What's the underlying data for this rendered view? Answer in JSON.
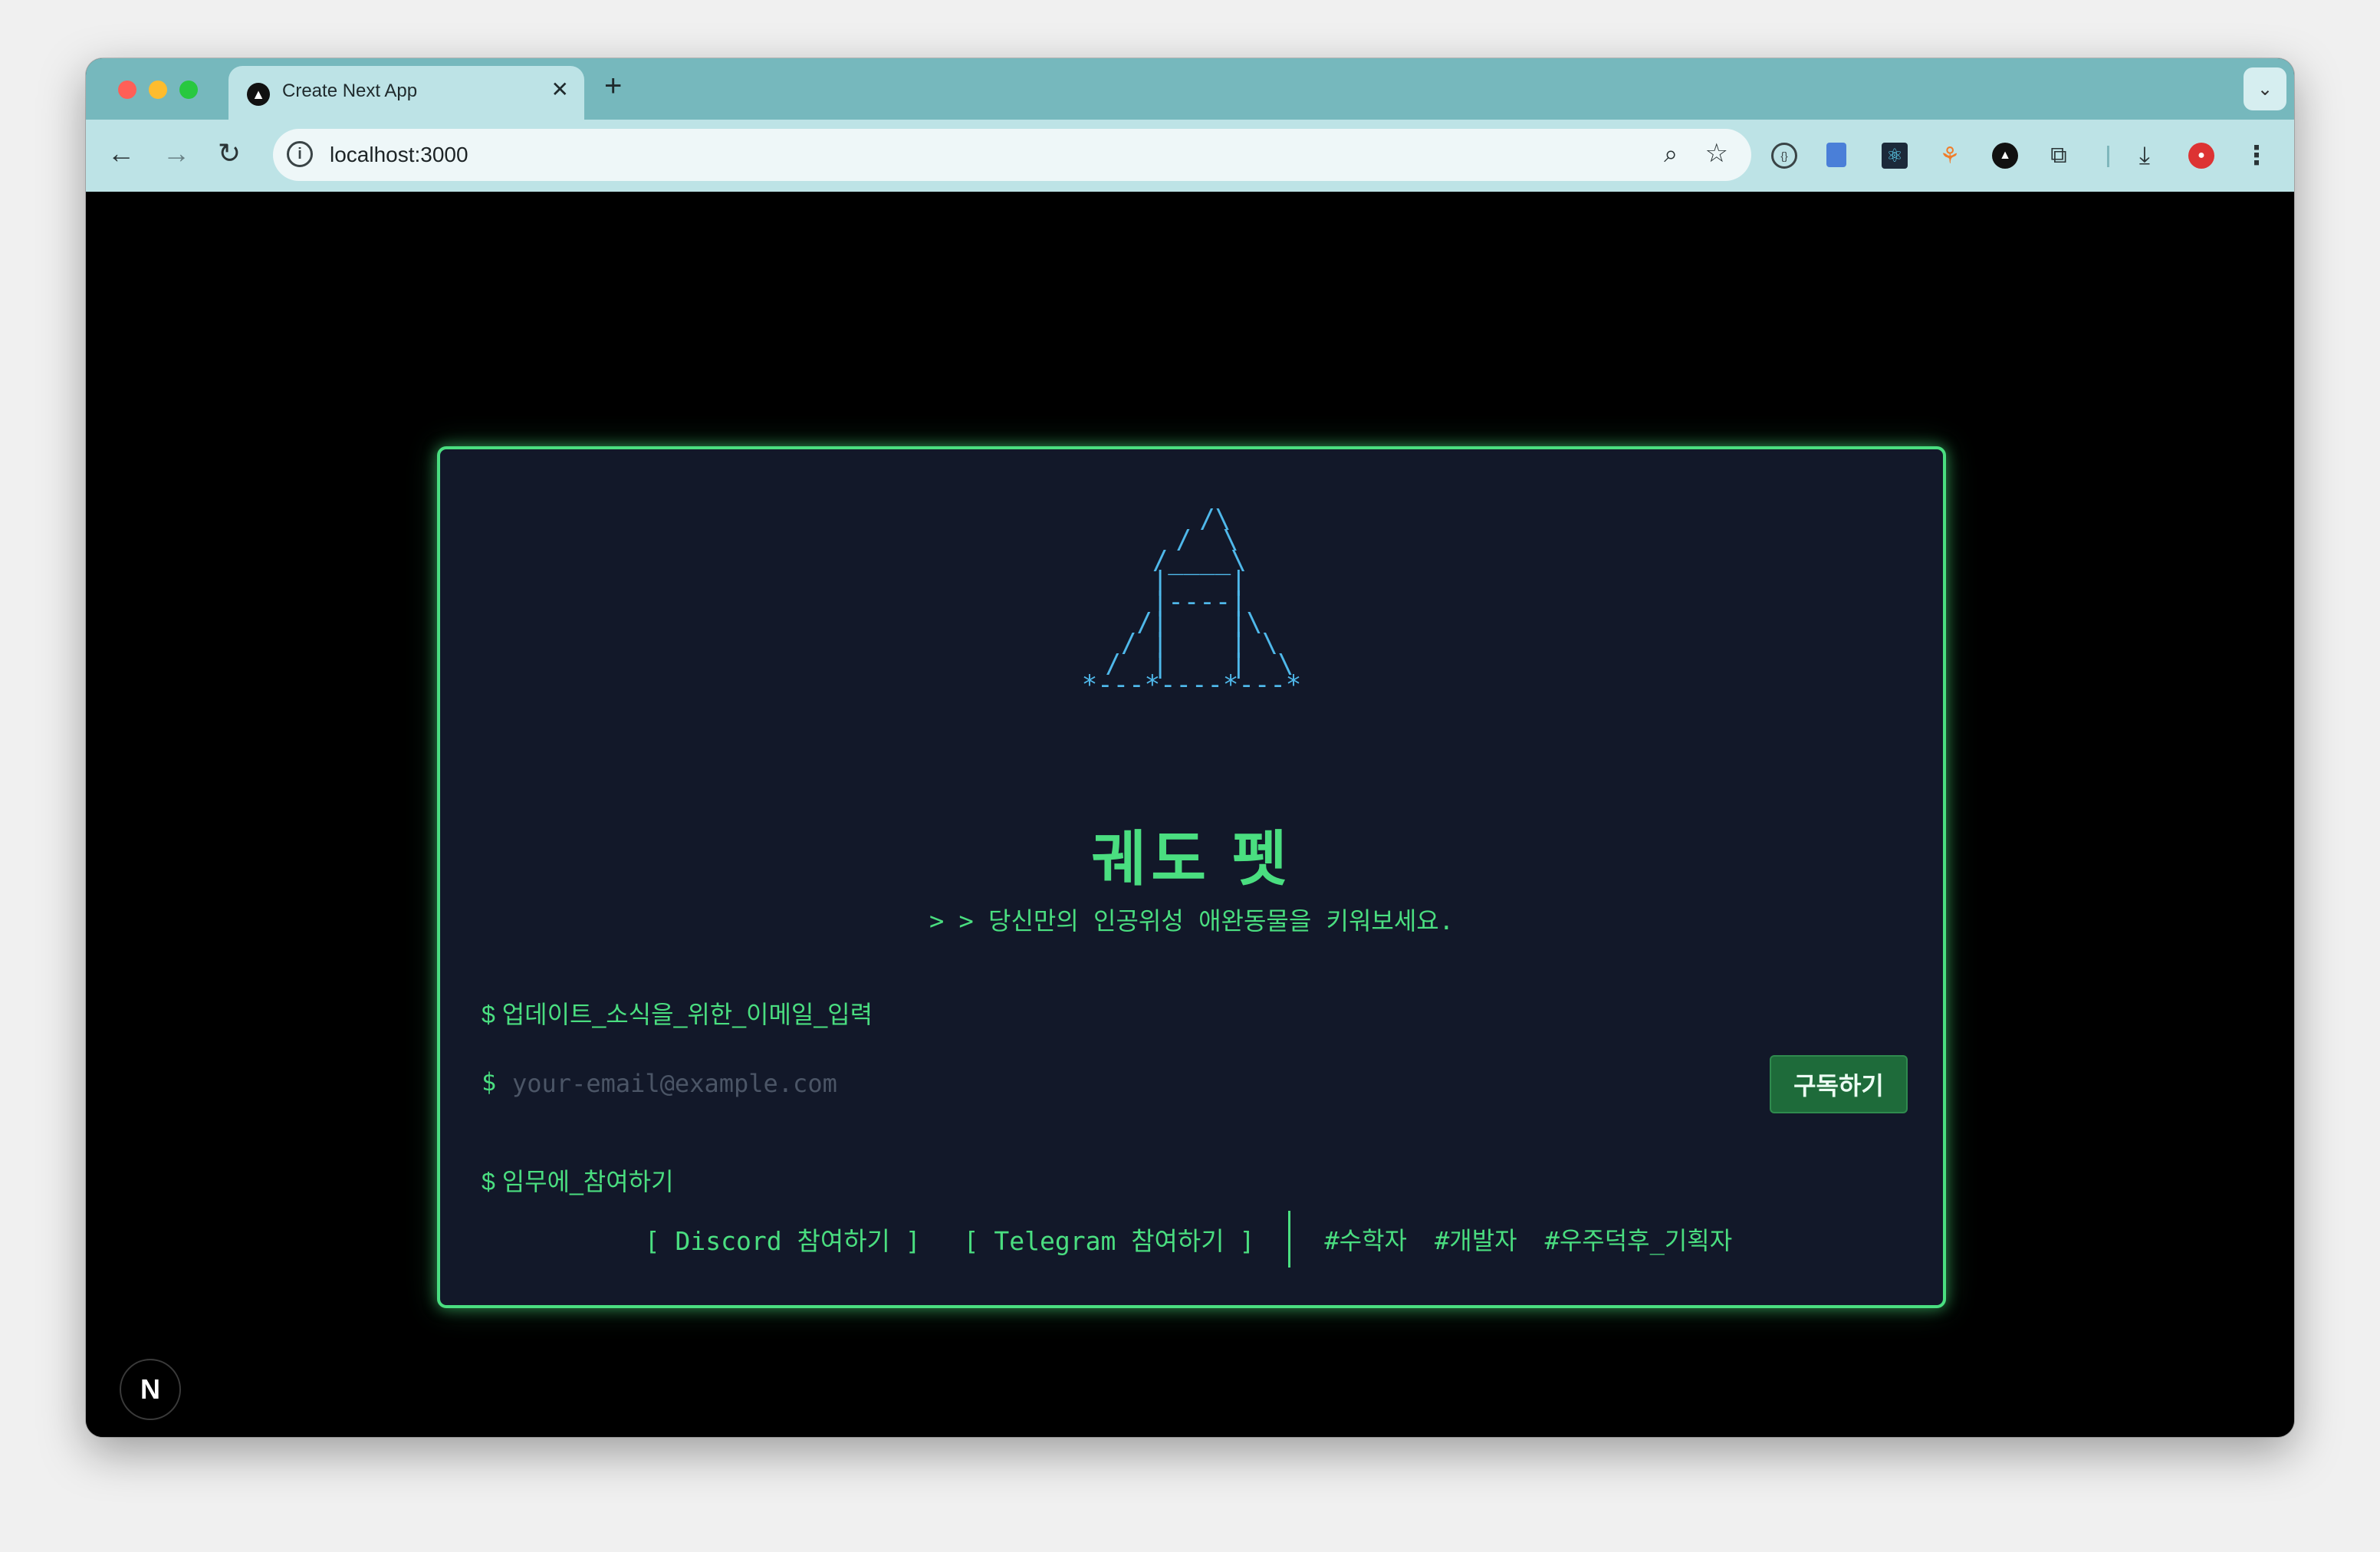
{
  "browser": {
    "tab_title": "Create Next App",
    "tab_favicon": "▲",
    "tab_close": "✕",
    "new_tab": "+",
    "tab_list": "⌄",
    "url": "localhost:3000",
    "nav": {
      "back": "←",
      "forward": "→",
      "reload": "↻"
    },
    "site_info": "i",
    "zoom": "⌕",
    "bookmark": "☆",
    "extensions": [
      "{}",
      "",
      "⚛",
      "⚘",
      "▲",
      "⧉",
      "⤓",
      "●",
      "⋮"
    ]
  },
  "page": {
    "ascii_art": "   /\\\n  /  \\\n /____\\\n |    |\n |----|\n /|    |\\\n / |    | \\\n /  |    |  \\\n*---*----*---*",
    "title": "궤도 펫",
    "subtitle": "> > 당신만의 인공위성 애완동물을 키워보세요.",
    "email_label": "$ 업데이트_소식을_위한_이메일_입력",
    "email_prompt": "$",
    "email_placeholder": "your-email@example.com",
    "subscribe_label": "구독하기",
    "mission_label": "$ 임무에_참여하기",
    "links": [
      "[ Discord 참여하기 ]",
      "[ Telegram 참여하기 ]"
    ],
    "tags": [
      "#수학자",
      "#개발자",
      "#우주덕후_기획자"
    ],
    "next_badge": "N"
  },
  "colors": {
    "accent_green": "#4ade80",
    "card_bg": "#121829",
    "ascii_blue": "#4fb8ea",
    "button_bg": "#1e6b3a",
    "tab_strip": "#76b8bd"
  }
}
